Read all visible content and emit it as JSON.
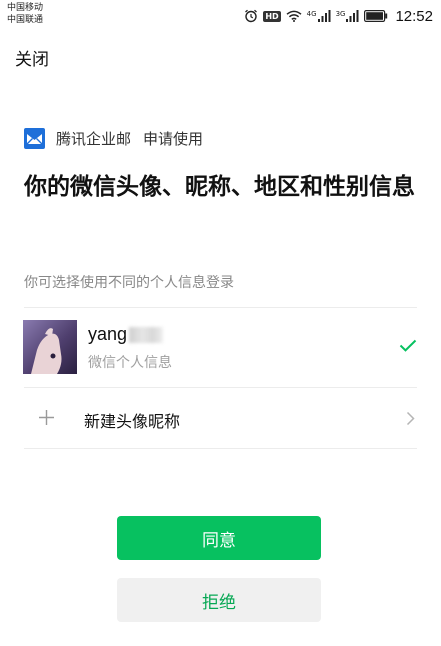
{
  "status_bar": {
    "carrier_1": "中国移动",
    "carrier_2": "中国联通",
    "hd_badge": "HD",
    "net_1": "4G",
    "net_2": "3G",
    "time": "12:52",
    "icons": [
      "alarm-icon",
      "wifi-icon",
      "signal-icon",
      "battery-icon"
    ]
  },
  "nav": {
    "close_label": "关闭"
  },
  "app": {
    "logo_icon": "tencent-exmail-logo-icon",
    "name": "腾讯企业邮",
    "action": "申请使用"
  },
  "request": {
    "title": "你的微信头像、昵称、地区和性别信息",
    "subtitle": "你可选择使用不同的个人信息登录"
  },
  "profile_option": {
    "name": "yang",
    "desc": "微信个人信息",
    "selected": true
  },
  "new_option": {
    "label": "新建头像昵称"
  },
  "buttons": {
    "agree": "同意",
    "reject": "拒绝"
  },
  "colors": {
    "accent_green": "#07c160",
    "reject_bg": "#f0f0f0",
    "reject_text": "#07a854",
    "secondary_text": "#888888"
  }
}
